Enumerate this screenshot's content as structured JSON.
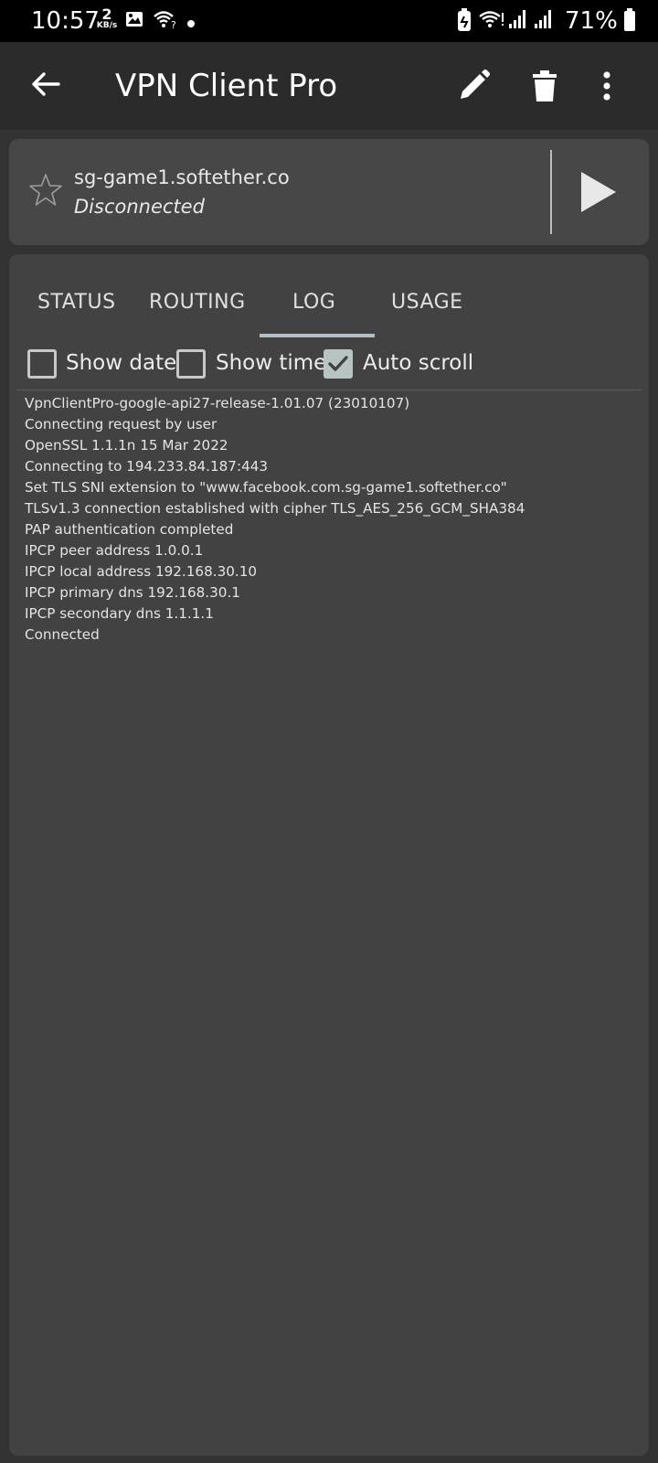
{
  "status_bar": {
    "time": "10:57",
    "net_speed_value": "2",
    "net_speed_unit": "KB/s",
    "battery": "71%",
    "icons": [
      "image-icon",
      "wifi-question-icon",
      "dot-icon",
      "battery-saver-icon",
      "wifi-icon",
      "signal-icon",
      "signal-icon",
      "battery-icon"
    ]
  },
  "appbar": {
    "title": "VPN Client Pro",
    "icons": [
      "back-arrow-icon",
      "pencil-icon",
      "trash-icon",
      "more-vert-icon"
    ]
  },
  "server": {
    "host": "sg-game1.softether.co",
    "state": "Disconnected",
    "favorite_icon": "star-outline-icon",
    "connect_icon": "play-icon"
  },
  "tabs": [
    {
      "label": "STATUS",
      "selected": false
    },
    {
      "label": "ROUTING",
      "selected": false
    },
    {
      "label": "LOG",
      "selected": true
    },
    {
      "label": "USAGE",
      "selected": false
    }
  ],
  "options": [
    {
      "label": "Show date",
      "checked": false
    },
    {
      "label": "Show time",
      "checked": false
    },
    {
      "label": "Auto scroll",
      "checked": true
    }
  ],
  "log_lines": [
    "VpnClientPro-google-api27-release-1.01.07 (23010107)",
    "Connecting request by user",
    "OpenSSL 1.1.1n  15 Mar 2022",
    "Connecting to 194.233.84.187:443",
    "Set TLS SNI extension to \"www.facebook.com.sg-game1.softether.co\"",
    "TLSv1.3 connection established with cipher TLS_AES_256_GCM_SHA384",
    "PAP authentication completed",
    "IPCP peer address 1.0.0.1",
    "IPCP local address 192.168.30.10",
    "IPCP primary dns 192.168.30.1",
    "IPCP secondary dns 1.1.1.1",
    "Connected"
  ],
  "colors": {
    "background": "#333333",
    "appbar": "#2b2b2b",
    "card": "#474747",
    "panel": "#424242",
    "tab_indicator": "#b0bec5",
    "checkbox_checked": "#b8c4c4"
  }
}
